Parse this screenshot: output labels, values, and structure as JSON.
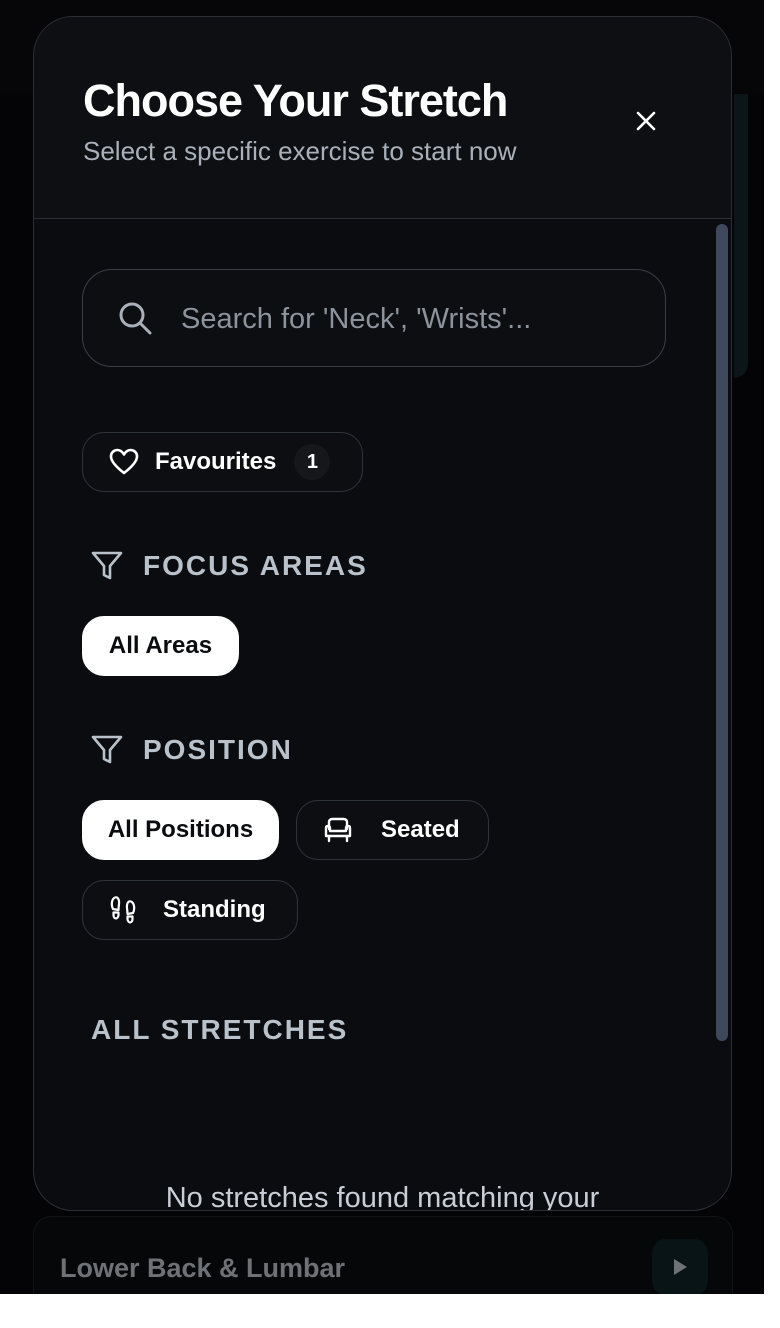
{
  "background": {
    "bottom_card_title": "Lower Back & Lumbar",
    "play_icon": "play-icon"
  },
  "modal": {
    "title": "Choose Your Stretch",
    "subtitle": "Select a specific exercise to start now",
    "close_icon": "close-icon"
  },
  "search": {
    "placeholder": "Search for 'Neck', 'Wrists'...",
    "value": "",
    "icon": "search-icon"
  },
  "favourites": {
    "label": "Favourites",
    "count": "1",
    "icon": "heart-icon"
  },
  "focus_areas": {
    "heading": "FOCUS AREAS",
    "icon": "filter-icon",
    "options": [
      {
        "label": "All Areas",
        "active": true
      }
    ]
  },
  "position": {
    "heading": "POSITION",
    "icon": "filter-icon",
    "options": [
      {
        "label": "All Positions",
        "active": true
      },
      {
        "label": "Seated",
        "active": false,
        "icon": "armchair-icon"
      },
      {
        "label": "Standing",
        "active": false,
        "icon": "footprints-icon"
      }
    ]
  },
  "stretches": {
    "heading": "ALL STRETCHES",
    "empty_message": "No stretches found matching your"
  },
  "colors": {
    "background": "#0b0c0f",
    "border": "#2b2f35",
    "active_pill": "#ffffff",
    "muted_text": "#a9b0b9",
    "scroll_thumb": "#3e4a5c"
  }
}
